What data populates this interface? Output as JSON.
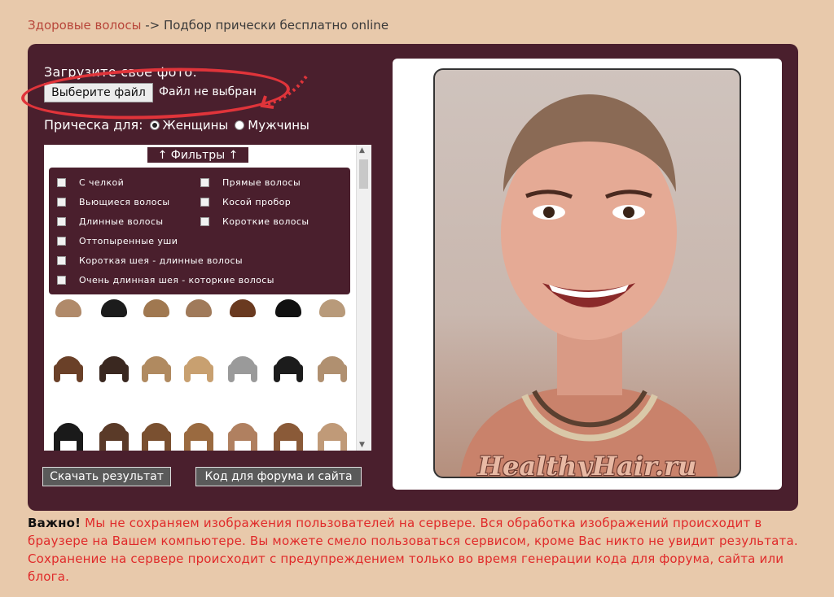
{
  "breadcrumb": {
    "link": "Здоровые волосы",
    "rest": "-> Подбор прически бесплатно online"
  },
  "upload": {
    "title": "Загрузите свое фото:",
    "button": "Выберите файл",
    "status": "Файл не выбран"
  },
  "gender": {
    "label": "Прическа для:",
    "options": [
      "Женщины",
      "Мужчины"
    ],
    "selected": "Женщины"
  },
  "filters": {
    "toggle": "↑ Фильтры ↑",
    "items": [
      "С челкой",
      "Прямые волосы",
      "Вьющиеся волосы",
      "Косой пробор",
      "Длинные волосы",
      "Короткие волосы",
      "Оттопыренные уши",
      "Короткая шея - длинные волосы",
      "Очень длинная шея - которкие волосы"
    ]
  },
  "actions": {
    "download": "Скачать результат",
    "code": "Код для форума и сайта"
  },
  "photo": {
    "watermark": "HealthyHair.ru"
  },
  "note": {
    "bold": "Важно!",
    "text": "Мы не сохраняем изображения пользователей на сервере. Вся обработка изображений происходит в браузере на Вашем компьютере. Вы можете смело пользоваться сервисом, кроме Вас никто не увидит результата. Сохранение на сервере происходит с предупреждением только во время генерации кода для форума, сайта или блога."
  }
}
